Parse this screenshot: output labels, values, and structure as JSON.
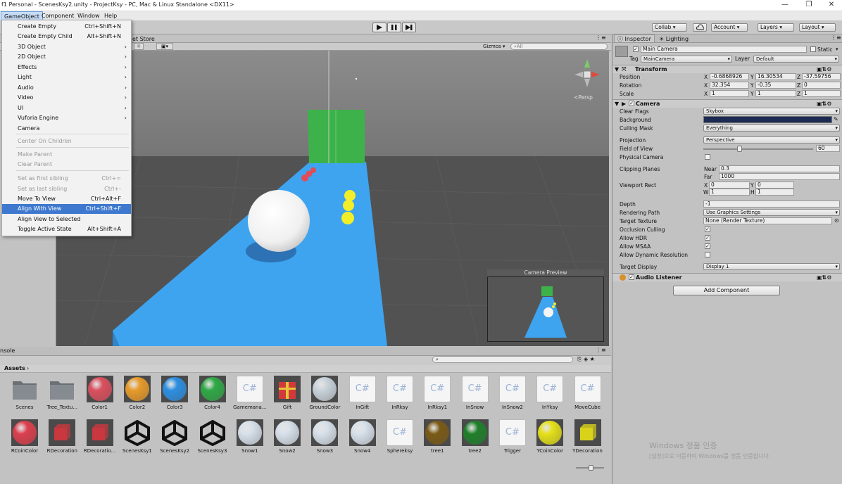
{
  "window": {
    "title": "f1 Personal - ScenesKsy2.unity - ProjectKsy - PC, Mac & Linux Standalone <DX11>",
    "controls": [
      "—",
      "❐",
      "✕"
    ]
  },
  "menubar": {
    "items": [
      "GameObject",
      "Component",
      "Window",
      "Help"
    ]
  },
  "gameobject_menu": {
    "items": [
      {
        "label": "Create Empty",
        "shortcut": "Ctrl+Shift+N"
      },
      {
        "label": "Create Empty Child",
        "shortcut": "Alt+Shift+N"
      },
      {
        "label": "3D Object",
        "shortcut": "›"
      },
      {
        "label": "2D Object",
        "shortcut": "›"
      },
      {
        "label": "Effects",
        "shortcut": "›"
      },
      {
        "label": "Light",
        "shortcut": "›"
      },
      {
        "label": "Audio",
        "shortcut": "›"
      },
      {
        "label": "Video",
        "shortcut": "›"
      },
      {
        "label": "UI",
        "shortcut": "›"
      },
      {
        "label": "Vuforia Engine",
        "shortcut": "›"
      },
      {
        "label": "Camera",
        "shortcut": ""
      },
      {
        "label": "Center On Children",
        "shortcut": ""
      },
      {
        "label": "Make Parent",
        "shortcut": ""
      },
      {
        "label": "Clear Parent",
        "shortcut": ""
      },
      {
        "label": "Set as first sibling",
        "shortcut": "Ctrl+="
      },
      {
        "label": "Set as last sibling",
        "shortcut": "Ctrl+-"
      },
      {
        "label": "Move To View",
        "shortcut": "Ctrl+Alt+F"
      },
      {
        "label": "Align With View",
        "shortcut": "Ctrl+Shift+F"
      },
      {
        "label": "Align View to Selected",
        "shortcut": ""
      },
      {
        "label": "Toggle Active State",
        "shortcut": "Alt+Shift+A"
      }
    ]
  },
  "toolbar": {
    "collab": "Collab ▾",
    "account": "Account",
    "layers": "Layers",
    "layout": "Layout"
  },
  "scene": {
    "tab_partial": "et Store",
    "gizmos": "Gizmos ▾",
    "search_placeholder": "All",
    "persp": "<Persp",
    "camera_preview_title": "Camera Preview"
  },
  "inspector": {
    "tabs": [
      "Inspector",
      "Lighting"
    ],
    "object_name": "Main Camera",
    "static_label": "Static",
    "tag_label": "Tag",
    "tag_value": "MainCamera",
    "layer_label": "Layer",
    "layer_value": "Default",
    "transform": {
      "title": "Transform",
      "position": {
        "label": "Position",
        "x": "-0.6868926",
        "y": "16.30534",
        "z": "-37.59756"
      },
      "rotation": {
        "label": "Rotation",
        "x": "32.354",
        "y": "-0.35",
        "z": "0"
      },
      "scale": {
        "label": "Scale",
        "x": "1",
        "y": "1",
        "z": "1"
      }
    },
    "camera": {
      "title": "Camera",
      "clear_flags_label": "Clear Flags",
      "clear_flags": "Skybox",
      "background_label": "Background",
      "background_color": "#1b2a52",
      "culling_mask_label": "Culling Mask",
      "culling_mask": "Everything",
      "projection_label": "Projection",
      "projection": "Perspective",
      "fov_label": "Field of View",
      "fov": "60",
      "fov_fraction": 0.33,
      "physical_label": "Physical Camera",
      "clipping_label": "Clipping Planes",
      "near_label": "Near",
      "near": "0.3",
      "far_label": "Far",
      "far": "1000",
      "viewport_label": "Viewport Rect",
      "vp_x": "0",
      "vp_y": "0",
      "vp_w": "1",
      "vp_h": "1",
      "depth_label": "Depth",
      "depth": "-1",
      "rendering_path_label": "Rendering Path",
      "rendering_path": "Use Graphics Settings",
      "target_texture_label": "Target Texture",
      "target_texture": "None (Render Texture)",
      "occlusion_label": "Occlusion Culling",
      "hdr_label": "Allow HDR",
      "msaa_label": "Allow MSAA",
      "dyn_res_label": "Allow Dynamic Resolution",
      "target_display_label": "Target Display",
      "target_display": "Display 1"
    },
    "audio_listener": {
      "title": "Audio Listener"
    },
    "add_component": "Add Component"
  },
  "project": {
    "console_tab_partial": "nsole",
    "assets_label": "Assets",
    "assets": [
      {
        "name": "Scenes",
        "kind": "folder"
      },
      {
        "name": "Tree_Textu...",
        "kind": "folder"
      },
      {
        "name": "Color1",
        "kind": "ball",
        "color": "#d9505e"
      },
      {
        "name": "Color2",
        "kind": "ball",
        "color": "#e79a2a"
      },
      {
        "name": "Color3",
        "kind": "ball",
        "color": "#2c8ee0"
      },
      {
        "name": "Color4",
        "kind": "ball",
        "color": "#2fa845"
      },
      {
        "name": "Gamemana...",
        "kind": "cs"
      },
      {
        "name": "Gift",
        "kind": "gift"
      },
      {
        "name": "GroundColor",
        "kind": "ball",
        "color": "#c9d2da"
      },
      {
        "name": "InGift",
        "kind": "cs"
      },
      {
        "name": "InRksy",
        "kind": "cs"
      },
      {
        "name": "InRksy1",
        "kind": "cs"
      },
      {
        "name": "InSnow",
        "kind": "cs"
      },
      {
        "name": "InSnow2",
        "kind": "cs"
      },
      {
        "name": "InYksy",
        "kind": "cs"
      },
      {
        "name": "MoveCube",
        "kind": "cs"
      },
      {
        "name": "RCoinColor",
        "kind": "ball",
        "color": "#db3f4d"
      },
      {
        "name": "RDecoration",
        "kind": "cube",
        "color": "#c9373f"
      },
      {
        "name": "RDecoratio...",
        "kind": "cube",
        "color": "#c9373f"
      },
      {
        "name": "ScenesKsy1",
        "kind": "unity"
      },
      {
        "name": "ScenesKsy2",
        "kind": "unity"
      },
      {
        "name": "ScenesKsy3",
        "kind": "unity"
      },
      {
        "name": "Snow1",
        "kind": "ball",
        "color": "#d7e0ea"
      },
      {
        "name": "Snow2",
        "kind": "ball",
        "color": "#d7e0ea"
      },
      {
        "name": "Snow3",
        "kind": "ball",
        "color": "#d7e0ea"
      },
      {
        "name": "Snow4",
        "kind": "ball",
        "color": "#d7e0ea"
      },
      {
        "name": "Sphereksy",
        "kind": "cs"
      },
      {
        "name": "tree1",
        "kind": "ball",
        "color": "#7a5a16"
      },
      {
        "name": "tree2",
        "kind": "ball",
        "color": "#1f7f2a"
      },
      {
        "name": "Trigger",
        "kind": "cs"
      },
      {
        "name": "YCoinColor",
        "kind": "ball",
        "color": "#e4e018"
      },
      {
        "name": "YDecoration",
        "kind": "cube",
        "color": "#d9d21a"
      }
    ]
  },
  "watermark": {
    "line1": "Windows 정품 인증",
    "line2": "[설정]으로 이동하여 Windows를 정품 인증합니다."
  }
}
